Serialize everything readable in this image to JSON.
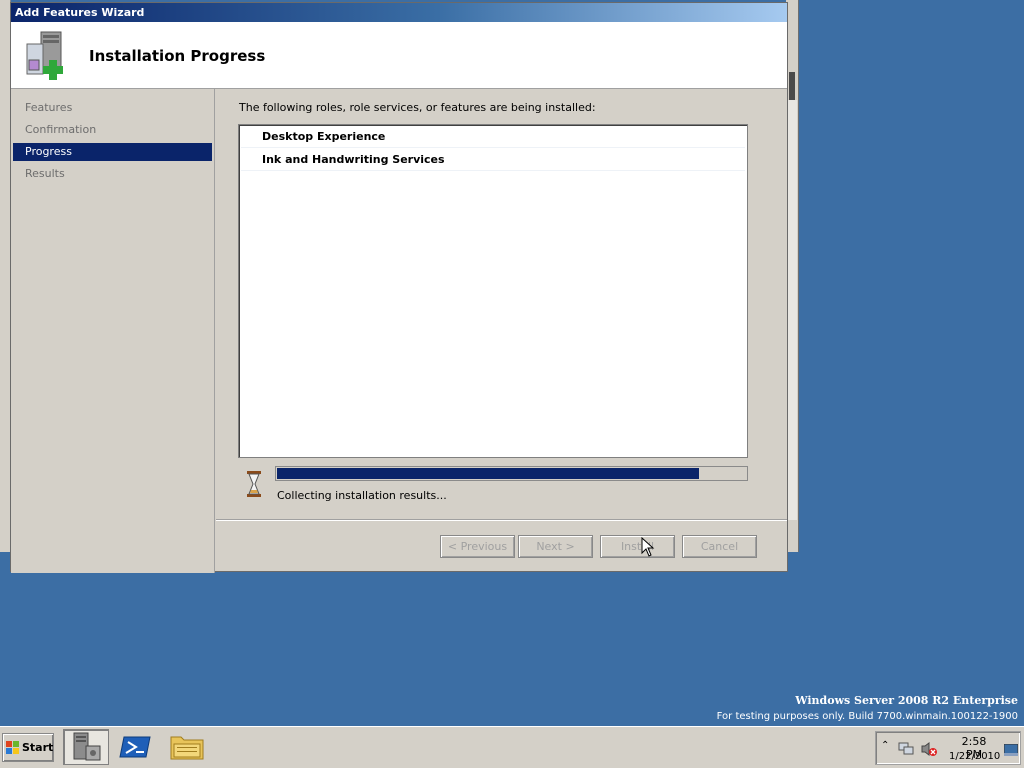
{
  "window": {
    "title": "Add Features Wizard",
    "header_title": "Installation Progress"
  },
  "nav": {
    "items": [
      {
        "label": "Features"
      },
      {
        "label": "Confirmation"
      },
      {
        "label": "Progress"
      },
      {
        "label": "Results"
      }
    ],
    "active": "Progress"
  },
  "content": {
    "intro": "The following roles, role services, or features are being installed:",
    "items": [
      {
        "label": "Desktop Experience"
      },
      {
        "label": "Ink and Handwriting Services"
      }
    ],
    "progress_fraction": 0.9,
    "status": "Collecting installation results..."
  },
  "buttons": {
    "previous": "< Previous",
    "next": "Next >",
    "install": "Install",
    "cancel": "Cancel"
  },
  "branding": {
    "edition": "Windows Server 2008 R2 Enterprise",
    "build": "For testing purposes only. Build 7700.winmain.100122-1900"
  },
  "taskbar": {
    "start_label": "Start",
    "pinned": [
      {
        "icon": "server-manager-icon"
      },
      {
        "icon": "powershell-icon"
      },
      {
        "icon": "explorer-folder-icon"
      }
    ],
    "tray_icons": [
      "show-hidden-icons-chevron-icon",
      "network-icon",
      "volume-muted-icon"
    ],
    "time": "2:58 PM",
    "date": "1/22/2010"
  },
  "colors": {
    "desktop": "#3c6ea4",
    "titlebar_start": "#0a246a",
    "selection": "#0a246a",
    "progress": "#0a246a"
  }
}
